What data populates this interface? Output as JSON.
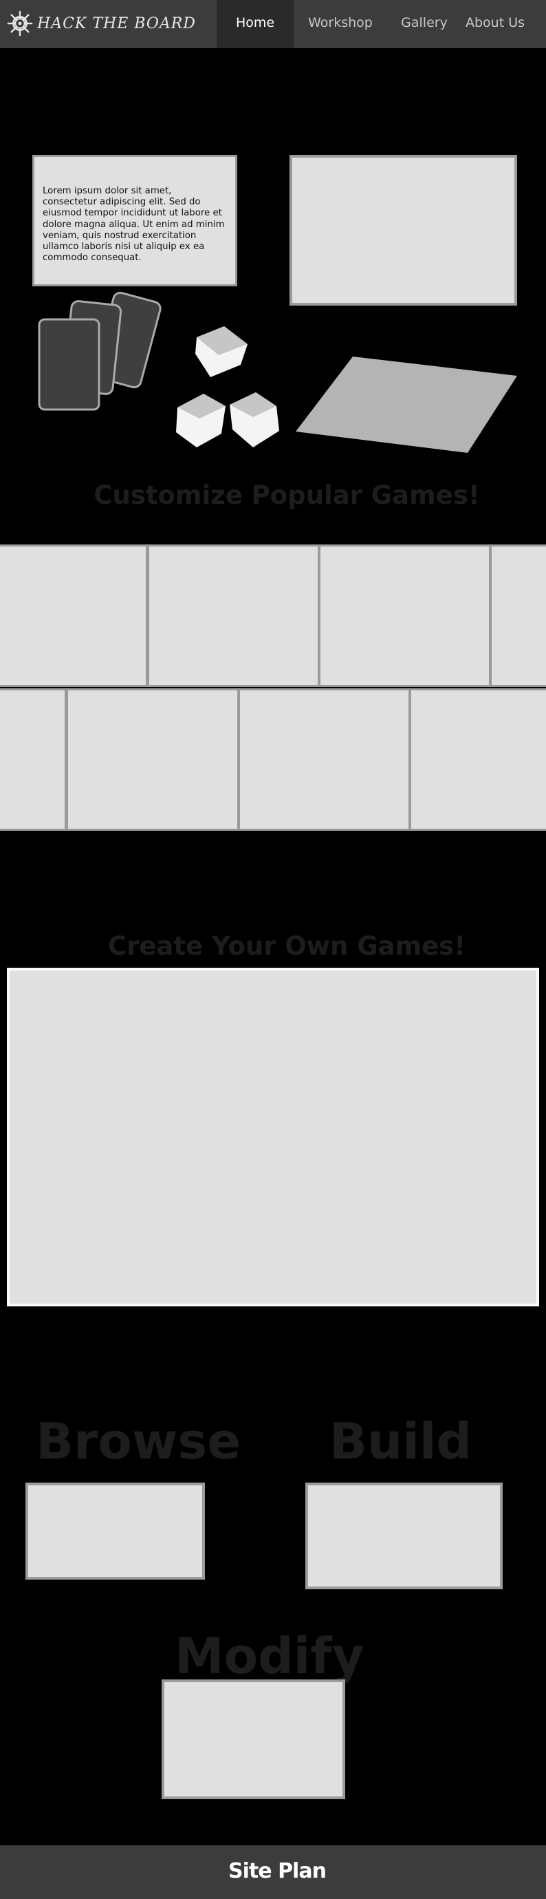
{
  "brand": {
    "name": "HACK THE BOARD",
    "logo_icon": "ship-wheel-icon"
  },
  "nav": {
    "items": [
      {
        "label": "Home",
        "active": true
      },
      {
        "label": "Workshop",
        "active": false
      },
      {
        "label": "Gallery",
        "active": false
      },
      {
        "label": "About Us",
        "active": false
      }
    ]
  },
  "hero": {
    "text": "Lorem ipsum dolor sit amet, consectetur adipiscing elit. Sed do eiusmod tempor incididunt ut labore et dolore magna aliqua. Ut enim ad minim veniam, quis nostrud exercitation ullamco laboris nisi ut aliquip ex ea commodo consequat."
  },
  "sections": {
    "customize_title": "Customize Popular Games!",
    "create_title": "Create Your Own Games!"
  },
  "features": {
    "browse": "Browse",
    "build": "Build",
    "modify": "Modify"
  },
  "footer": {
    "label": "Site Plan"
  },
  "colors": {
    "background": "#000000",
    "nav_bg": "#3c3c3c",
    "nav_active_bg": "#2a2a2a",
    "placeholder_fill": "#e0e0e0",
    "placeholder_border": "#9b9b9b",
    "title_text": "#1d1d1d"
  }
}
